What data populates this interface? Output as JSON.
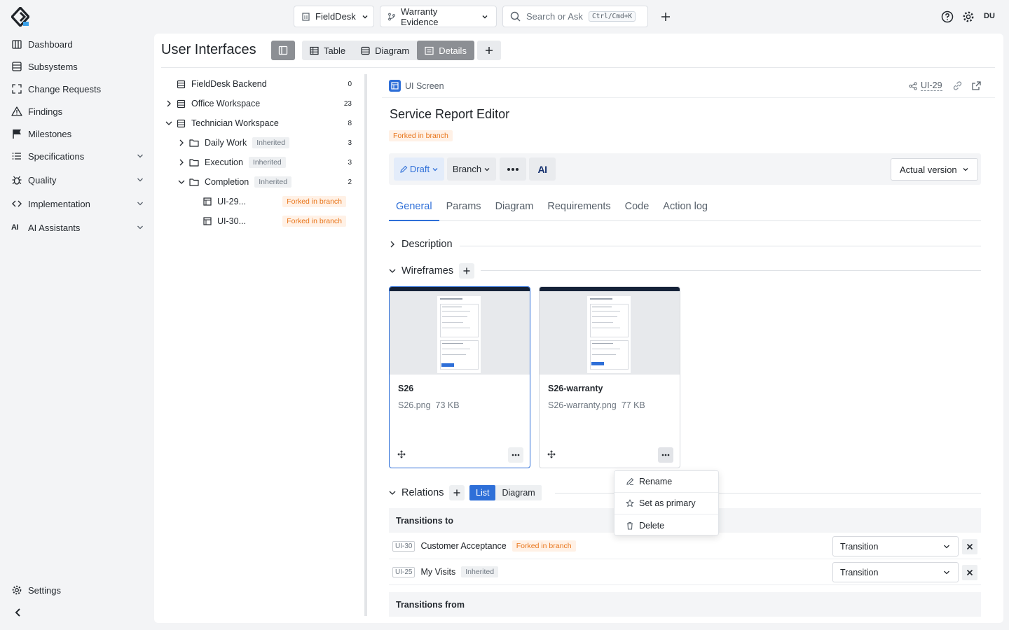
{
  "topbar": {
    "workspace": "FieldDesk",
    "branch": "Warranty Evidence",
    "search_placeholder": "Search or Ask",
    "search_shortcut": "Ctrl/Cmd+K",
    "user_initials": "DU"
  },
  "sidebar": {
    "items": [
      {
        "label": "Dashboard",
        "icon": "dashboard-icon"
      },
      {
        "label": "Subsystems",
        "icon": "subsystems-icon"
      },
      {
        "label": "Change Requests",
        "icon": "change-requests-icon"
      },
      {
        "label": "Findings",
        "icon": "warning-icon"
      },
      {
        "label": "Milestones",
        "icon": "flag-icon"
      },
      {
        "label": "Specifications",
        "icon": "list-icon"
      },
      {
        "label": "Quality",
        "icon": "bug-icon"
      },
      {
        "label": "Implementation",
        "icon": "code-icon"
      },
      {
        "label": "AI Assistants",
        "icon": "ai-icon"
      }
    ],
    "settings": "Settings"
  },
  "page": {
    "title": "User Interfaces",
    "view_tabs": [
      {
        "label": "Table"
      },
      {
        "label": "Diagram"
      },
      {
        "label": "Details"
      }
    ],
    "active_view": "Details"
  },
  "tree": {
    "rows": [
      {
        "label": "FieldDesk Backend",
        "count": "0"
      },
      {
        "label": "Office Workspace",
        "count": "23"
      },
      {
        "label": "Technician Workspace",
        "count": "8"
      },
      {
        "label": "Daily Work",
        "badge": "Inherited",
        "count": "3"
      },
      {
        "label": "Execution",
        "badge": "Inherited",
        "count": "3"
      },
      {
        "label": "Completion",
        "badge": "Inherited",
        "count": "2"
      },
      {
        "label": "UI-29...",
        "badge": "Forked in branch"
      },
      {
        "label": "UI-30...",
        "badge": "Forked in branch"
      }
    ]
  },
  "detail": {
    "type": "UI Screen",
    "id": "UI-29",
    "title": "Service Report Editor",
    "status_badge": "Forked in branch",
    "toolbar": {
      "draft": "Draft",
      "branch": "Branch",
      "ai": "AI",
      "version": "Actual version"
    },
    "tabs": [
      {
        "label": "General"
      },
      {
        "label": "Params"
      },
      {
        "label": "Diagram"
      },
      {
        "label": "Requirements"
      },
      {
        "label": "Code"
      },
      {
        "label": "Action log"
      }
    ],
    "sections": {
      "description": "Description",
      "wireframes": "Wireframes",
      "relations": "Relations"
    },
    "wireframes": [
      {
        "name": "S26",
        "file": "S26.png",
        "size": "73 KB"
      },
      {
        "name": "S26-warranty",
        "file": "S26-warranty.png",
        "size": "77 KB"
      }
    ],
    "context_menu": {
      "rename": "Rename",
      "set_primary": "Set as primary",
      "delete": "Delete"
    },
    "relations": {
      "view_list": "List",
      "view_diagram": "Diagram",
      "transitions_to": "Transitions to",
      "transitions_from": "Transitions from",
      "rows": [
        {
          "id": "UI-30",
          "name": "Customer Acceptance",
          "badge": "Forked in branch",
          "type": "Transition"
        },
        {
          "id": "UI-25",
          "name": "My Visits",
          "badge": "Inherited",
          "type": "Transition"
        }
      ]
    }
  },
  "colors": {
    "accent": "#2e6fd8",
    "fork_badge_text": "#e8751a",
    "fork_badge_bg": "#fff1e6"
  }
}
